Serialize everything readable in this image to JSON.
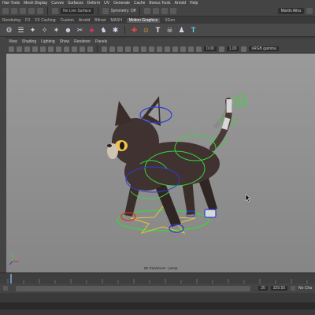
{
  "menubar": {
    "items": [
      "Hair Tools",
      "Mesh Display",
      "Curves",
      "Surfaces",
      "Deform",
      "UV",
      "Generate",
      "Cache",
      "Bonus Tools",
      "Arnold",
      "Help"
    ]
  },
  "status": {
    "selection_field": "No Live Surface",
    "symmetry_label": "Symmetry: Off",
    "user": "Martin Aitra"
  },
  "shelf": {
    "tabs": [
      "Rendering",
      "FX",
      "FX Caching",
      "Custom",
      "Arnold",
      "Bifrost",
      "MASH",
      "Motion Graphics",
      "XGen"
    ],
    "active_tab": "Motion Graphics"
  },
  "panel": {
    "menu": [
      "View",
      "Shading",
      "Lighting",
      "Show",
      "Renderer",
      "Panels"
    ],
    "field_a": "0.00",
    "field_b": "1.00",
    "color_space": "sRGB gamma"
  },
  "viewport": {
    "camera_label": "2D Pan/Zoom : persp"
  },
  "range": {
    "start_field": "20",
    "end_field": "329.50",
    "char_set": "No Cha"
  },
  "colors": {
    "viewport_bg": "#8e8e8e",
    "cat_body": "#3f3230",
    "control_green": "#3cd23c",
    "control_blue": "#2d3dd6",
    "control_yellow": "#e7c52e",
    "control_red": "#d63030"
  }
}
